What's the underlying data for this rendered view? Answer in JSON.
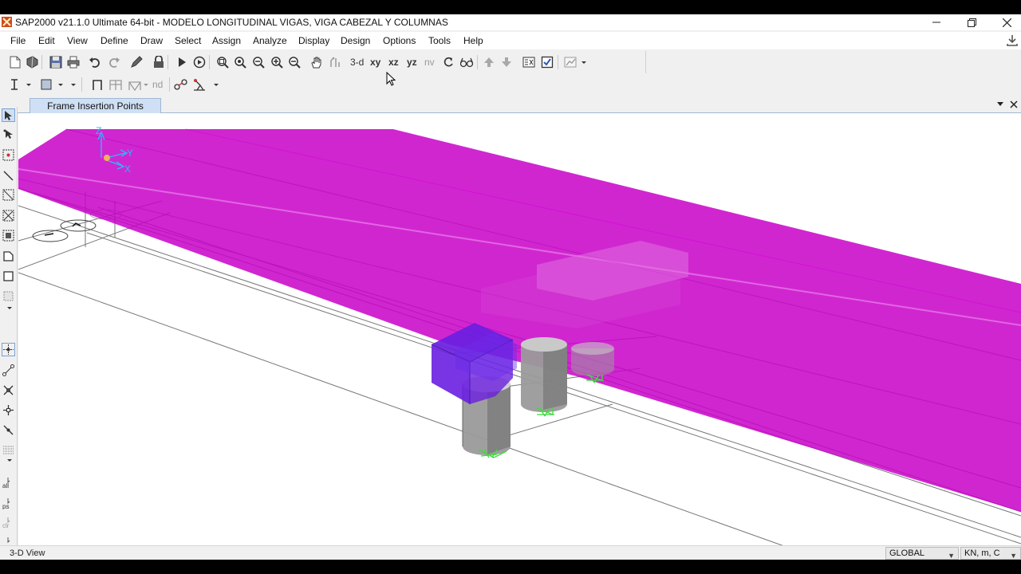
{
  "app": {
    "title": "SAP2000 v21.1.0 Ultimate 64-bit - MODELO LONGITUDINAL VIGAS, VIGA CABEZAL Y COLUMNAS",
    "window_controls": [
      "minimize-icon",
      "restore-icon",
      "close-icon"
    ]
  },
  "menu": {
    "items": [
      "File",
      "Edit",
      "View",
      "Define",
      "Draw",
      "Select",
      "Assign",
      "Analyze",
      "Display",
      "Design",
      "Options",
      "Tools",
      "Help"
    ]
  },
  "toolbar": {
    "view_3d": "3-d",
    "view_xy": "xy",
    "view_xz": "xz",
    "view_yz": "yz",
    "view_nv": "nv",
    "text_nd": "nd"
  },
  "document": {
    "tab_label": "Frame Insertion Points"
  },
  "viewport": {
    "axis_z": "Z",
    "axis_y": "Y",
    "axis_x": "X",
    "colors": {
      "beam": "#c800c8",
      "cap_beam": "#6a1ee0",
      "column": "#9a9a9a",
      "support": "#3ddc3d",
      "axis": "#2bb6ff",
      "grid": "#777777"
    }
  },
  "status": {
    "view_label": "3-D View",
    "coord_system": "GLOBAL",
    "units": "KN, m, C"
  }
}
